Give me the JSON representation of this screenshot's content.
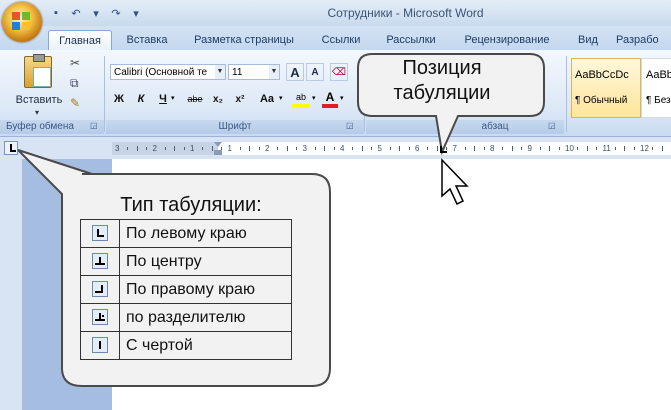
{
  "window": {
    "title": "Сотрудники - Microsoft Word"
  },
  "tabs": [
    {
      "label": "Главная",
      "active": true
    },
    {
      "label": "Вставка"
    },
    {
      "label": "Разметка страницы"
    },
    {
      "label": "Ссылки"
    },
    {
      "label": "Рассылки"
    },
    {
      "label": "Рецензирование"
    },
    {
      "label": "Вид"
    },
    {
      "label": "Разрабо"
    }
  ],
  "ribbon": {
    "clipboard": {
      "paste_label": "Вставить",
      "group_label": "Буфер обмена"
    },
    "font": {
      "font_name": "Calibri (Основной те",
      "font_size": "11",
      "group_label": "Шрифт",
      "buttons": [
        "Ж",
        "К",
        "Ч",
        "abe",
        "x₂",
        "x²",
        "Aa"
      ]
    },
    "paragraph": {
      "group_label": "абзац"
    },
    "styles": [
      {
        "preview": "AaBbCcDc",
        "name": "¶ Обычный"
      },
      {
        "preview": "AaBb",
        "name": "¶ Без"
      }
    ]
  },
  "ruler": {
    "numbers": [
      "3",
      "2",
      "1",
      "1",
      "2",
      "3",
      "4",
      "5",
      "6",
      "7",
      "8",
      "9",
      "10",
      "11",
      "12"
    ]
  },
  "callouts": {
    "position": {
      "line1": "Позиция",
      "line2": "табуляции"
    },
    "tab_types": {
      "title": "Тип табуляции:",
      "items": [
        {
          "label": "По левому краю",
          "icon": "tab-left-icon"
        },
        {
          "label": "По центру",
          "icon": "tab-center-icon"
        },
        {
          "label": "По правому краю",
          "icon": "tab-right-icon"
        },
        {
          "label": "по разделителю",
          "icon": "tab-decimal-icon"
        },
        {
          "label": "С чертой",
          "icon": "tab-bar-icon"
        }
      ]
    }
  },
  "colors": {
    "ribbon": "#dce8f6",
    "document_bg": "#a4bde0",
    "callout_fill": "#f2f2f2"
  }
}
